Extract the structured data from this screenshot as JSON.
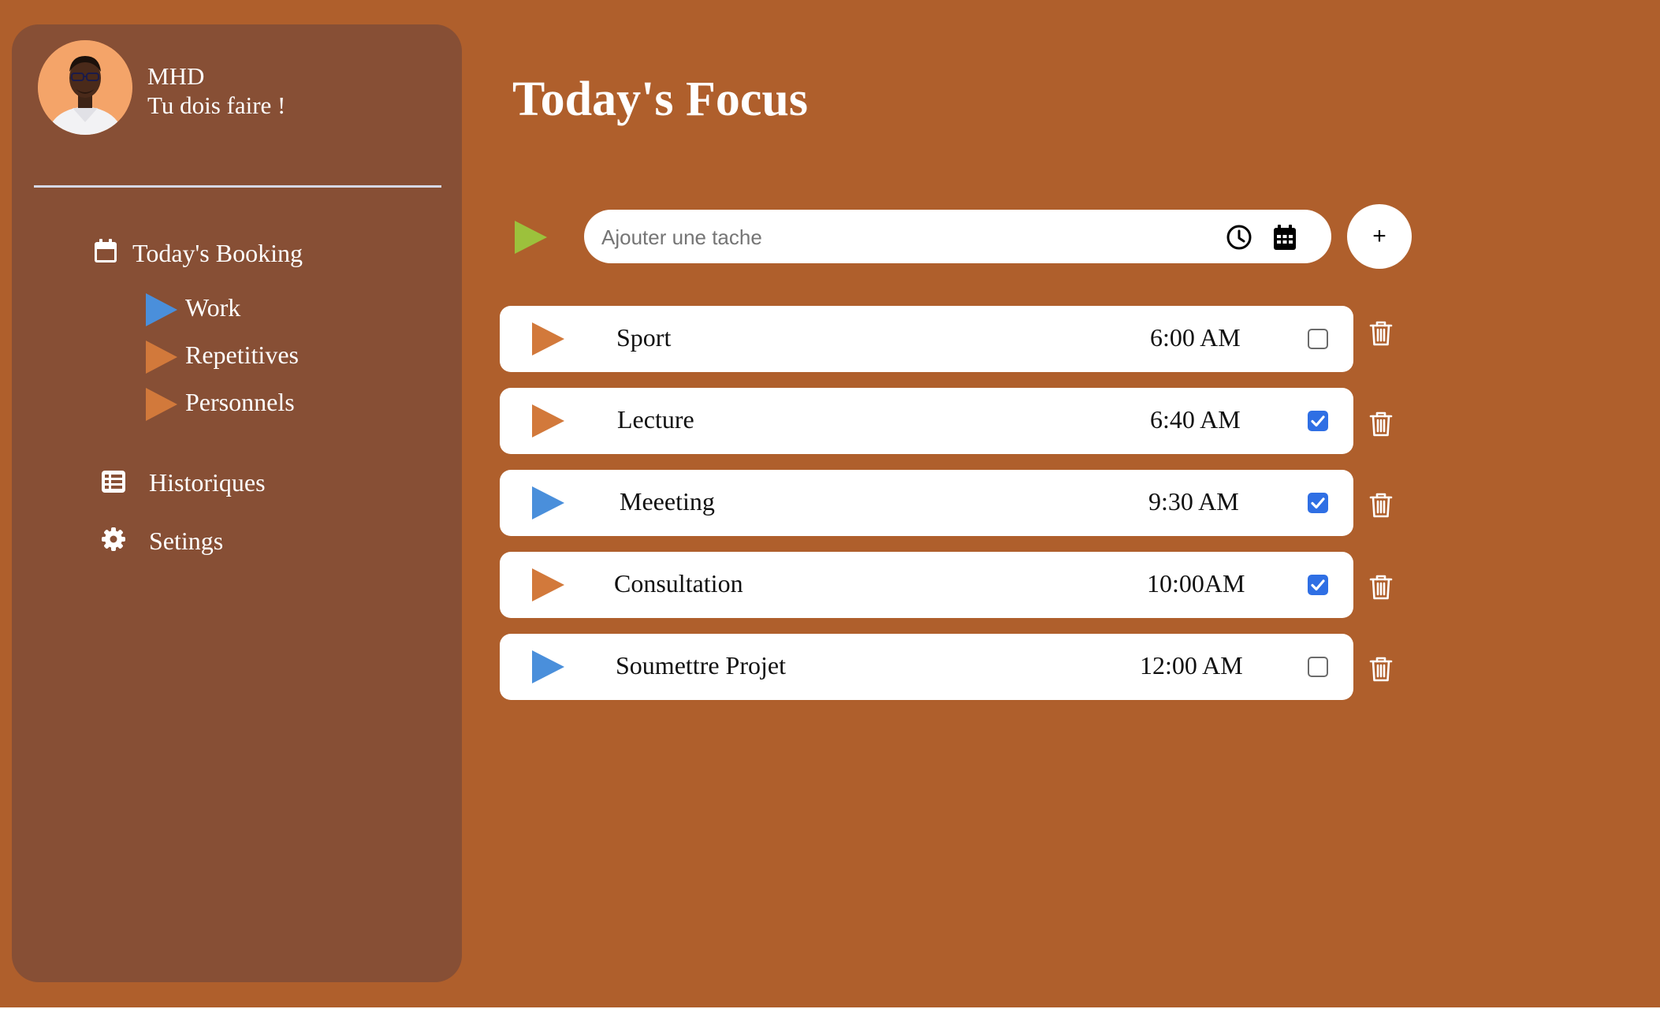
{
  "profile": {
    "name": "MHD",
    "tagline": "Tu dois faire !"
  },
  "nav": {
    "booking": {
      "label": "Today's Booking",
      "icon": "calendar-icon",
      "subitems": [
        {
          "label": "Work",
          "color": "#4a8fdb"
        },
        {
          "label": "Repetitives",
          "color": "#d2793b"
        },
        {
          "label": "Personnels",
          "color": "#d2793b"
        }
      ]
    },
    "history": {
      "label": "Historiques",
      "icon": "table-list-icon"
    },
    "settings": {
      "label": "Setings",
      "icon": "gear-icon"
    }
  },
  "main": {
    "title": "Today's Focus",
    "new_task": {
      "placeholder": "Ajouter une tache",
      "add_label": "+",
      "play_color": "#9cc13c"
    },
    "tasks": [
      {
        "name": "Sport",
        "time": "6:00 AM",
        "done": false,
        "color": "#d2793b"
      },
      {
        "name": "Lecture",
        "time": "6:40 AM",
        "done": true,
        "color": "#d2793b"
      },
      {
        "name": "Meeeting",
        "time": "9:30 AM",
        "done": true,
        "color": "#4a8fdb"
      },
      {
        "name": "Consultation",
        "time": "10:00AM",
        "done": true,
        "color": "#d2793b"
      },
      {
        "name": "Soumettre Projet",
        "time": "12:00 AM",
        "done": false,
        "color": "#4a8fdb"
      }
    ]
  },
  "colors": {
    "background": "#af5f2c",
    "sidebar": "#874f35",
    "accent_blue": "#4a8fdb",
    "accent_orange": "#d2793b",
    "checkbox_checked": "#2f6fe4"
  }
}
